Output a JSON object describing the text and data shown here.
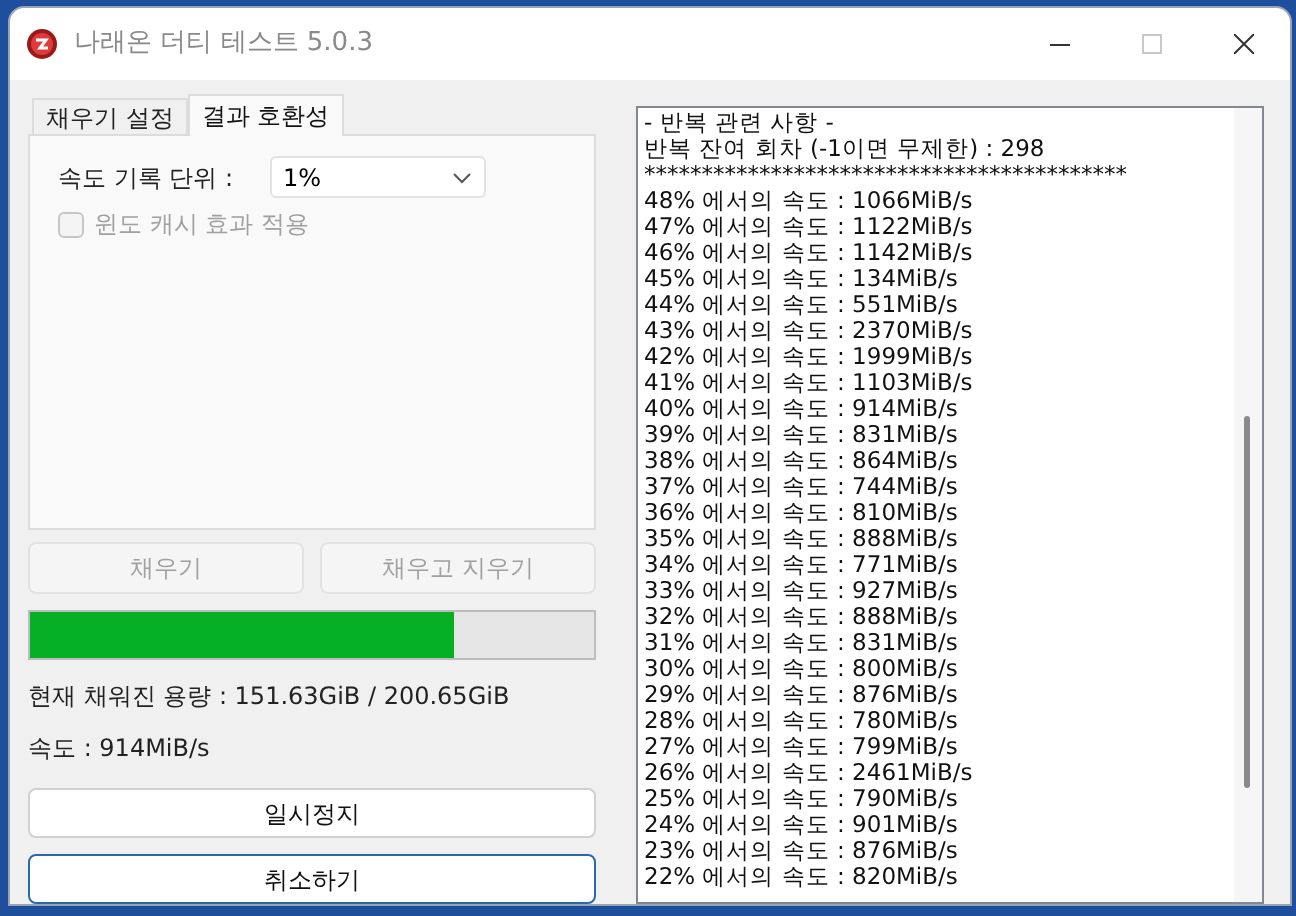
{
  "window": {
    "title": "나래온 더티 테스트 5.0.3"
  },
  "tabs": [
    {
      "label": "채우기 설정",
      "selected": false
    },
    {
      "label": "결과 호환성",
      "selected": true
    }
  ],
  "settings": {
    "speed_unit_label": "속도 기록 단위 :",
    "speed_unit_value": "1%",
    "cache_checkbox": {
      "label": "윈도 캐시 효과 적용",
      "checked": false,
      "disabled": true
    }
  },
  "action_buttons": [
    {
      "label": "채우기",
      "disabled": true
    },
    {
      "label": "채우고 지우기",
      "disabled": true
    }
  ],
  "progress": {
    "level": 0.75
  },
  "filled_text": "현재 채워진 용량 : 151.63GiB / 200.65GiB",
  "speed_text": "속도 : 914MiB/s",
  "buttons": [
    {
      "label": "일시정지",
      "focused": false
    },
    {
      "label": "취소하기",
      "focused": true
    }
  ],
  "log": [
    "- 반복 관련 사항 -",
    "반복 잔여 회차 (-1이면 무제한) : 298",
    "******************************************",
    "48% 에서의 속도 : 1066MiB/s",
    "47% 에서의 속도 : 1122MiB/s",
    "46% 에서의 속도 : 1142MiB/s",
    "45% 에서의 속도 : 134MiB/s",
    "44% 에서의 속도 : 551MiB/s",
    "43% 에서의 속도 : 2370MiB/s",
    "42% 에서의 속도 : 1999MiB/s",
    "41% 에서의 속도 : 1103MiB/s",
    "40% 에서의 속도 : 914MiB/s",
    "39% 에서의 속도 : 831MiB/s",
    "38% 에서의 속도 : 864MiB/s",
    "37% 에서의 속도 : 744MiB/s",
    "36% 에서의 속도 : 810MiB/s",
    "35% 에서의 속도 : 888MiB/s",
    "34% 에서의 속도 : 771MiB/s",
    "33% 에서의 속도 : 927MiB/s",
    "32% 에서의 속도 : 888MiB/s",
    "31% 에서의 속도 : 831MiB/s",
    "30% 에서의 속도 : 800MiB/s",
    "29% 에서의 속도 : 876MiB/s",
    "28% 에서의 속도 : 780MiB/s",
    "27% 에서의 속도 : 799MiB/s",
    "26% 에서의 속도 : 2461MiB/s",
    "25% 에서의 속도 : 790MiB/s",
    "24% 에서의 속도 : 901MiB/s",
    "23% 에서의 속도 : 876MiB/s",
    "22% 에서의 속도 : 820MiB/s"
  ]
}
